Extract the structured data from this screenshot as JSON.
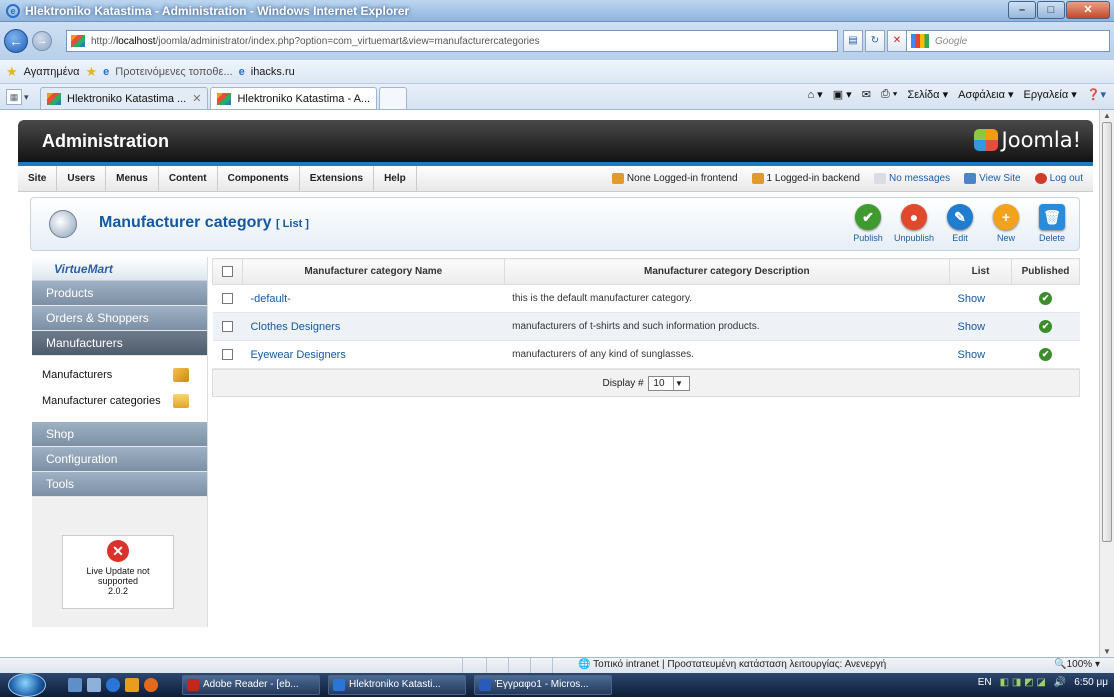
{
  "window": {
    "title": "Hlektroniko Katastima - Administration - Windows Internet Explorer",
    "url_prefix": "http://",
    "url_host": "localhost",
    "url_path": "/joomla/administrator/index.php?option=com_virtuemart&view=manufacturercategories",
    "search_placeholder": "Google"
  },
  "favorites": {
    "label": "Αγαπημένα",
    "suggested": "Προτεινόμενες τοποθε...",
    "link": "ihacks.ru"
  },
  "tabs": [
    {
      "label": "Hlektroniko Katastima ..."
    },
    {
      "label": "Hlektroniko Katastima - A..."
    }
  ],
  "command_bar": {
    "page": "Σελίδα ▾",
    "safety": "Ασφάλεια ▾",
    "tools": "Εργαλεία ▾"
  },
  "admin": {
    "title": "Administration",
    "logo": "Joomla!"
  },
  "menu": {
    "items": [
      "Site",
      "Users",
      "Menus",
      "Content",
      "Components",
      "Extensions",
      "Help"
    ],
    "status_frontend": "None Logged-in frontend",
    "status_backend": "1 Logged-in backend",
    "messages": "No messages",
    "view_site": "View Site",
    "logout": "Log out"
  },
  "toolbar": {
    "title": "Manufacturer category",
    "subtitle": "[ List ]",
    "buttons": [
      {
        "label": "Publish",
        "color": "#3f9b2f",
        "glyph": "✔"
      },
      {
        "label": "Unpublish",
        "color": "#e0492c",
        "glyph": "●"
      },
      {
        "label": "Edit",
        "color": "#1f7ccf",
        "glyph": "✎"
      },
      {
        "label": "New",
        "color": "#f2a21b",
        "glyph": "+"
      },
      {
        "label": "Delete",
        "color": "#2a8bd8",
        "glyph": "🗑"
      }
    ]
  },
  "sidebar": {
    "logo": "VirtueMart",
    "items": [
      "Products",
      "Orders & Shoppers",
      "Manufacturers"
    ],
    "sub_items": [
      "Manufacturers",
      "Manufacturer categories"
    ],
    "items_bottom": [
      "Shop",
      "Configuration",
      "Tools"
    ],
    "live_update": {
      "line1": "Live Update not",
      "line2": "supported",
      "version": "2.0.2"
    }
  },
  "table": {
    "headers": [
      "Manufacturer category Name",
      "Manufacturer category Description",
      "List",
      "Published"
    ],
    "rows": [
      {
        "name": "-default-",
        "description": "this is the default manufacturer category.",
        "list": "Show",
        "published": true
      },
      {
        "name": "Clothes Designers",
        "description": "manufacturers of t-shirts and such information products.",
        "list": "Show",
        "published": true
      },
      {
        "name": "Eyewear Designers",
        "description": "manufacturers of any kind of sunglasses.",
        "list": "Show",
        "published": true
      }
    ],
    "display_label": "Display #",
    "display_value": "10"
  },
  "ie_status": {
    "zone": "Τοπικό intranet | Προστατευμένη κατάσταση λειτουργίας: Ανενεργή",
    "zoom": "100%"
  },
  "taskbar": {
    "items": [
      {
        "label": "Adobe Reader - [eb...",
        "color": "#c0281c"
      },
      {
        "label": "Hlektroniko Katasti...",
        "color": "#2a75d8"
      },
      {
        "label": "Έγγραφο1 - Micros...",
        "color": "#2a5bb8"
      }
    ],
    "lang": "EN",
    "time": "6:50 μμ"
  }
}
